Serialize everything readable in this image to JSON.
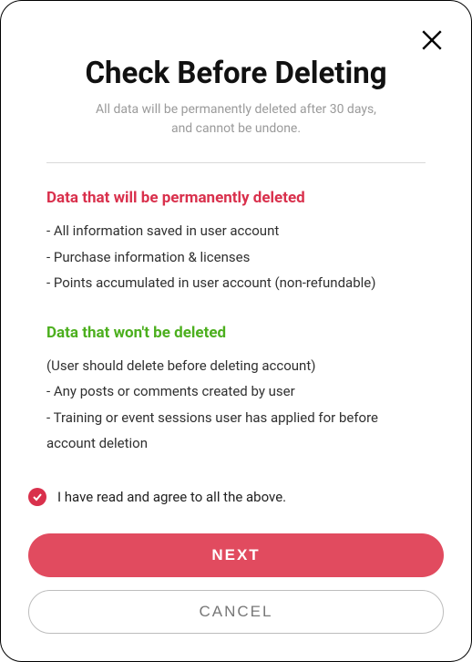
{
  "title": "Check Before Deleting",
  "subtitle_line1": "All data will be permanently deleted after 30 days,",
  "subtitle_line2": "and cannot be undone.",
  "section_deleted": {
    "heading": "Data that will be permanently deleted",
    "items": [
      "- All information saved in user account",
      "- Purchase information & licenses",
      "- Points accumulated in user account (non-refundable)"
    ]
  },
  "section_kept": {
    "heading": "Data that won't be deleted",
    "note": "(User should delete before deleting account)",
    "items": [
      "- Any posts or comments created by user",
      "- Training or event sessions user has applied for before account deletion"
    ]
  },
  "agree_label": "I have read and agree to all the above.",
  "agree_checked": true,
  "buttons": {
    "next": "NEXT",
    "cancel": "CANCEL"
  },
  "colors": {
    "danger": "#d9304c",
    "success": "#4caf1e",
    "primary_btn": "#e14b5f"
  }
}
